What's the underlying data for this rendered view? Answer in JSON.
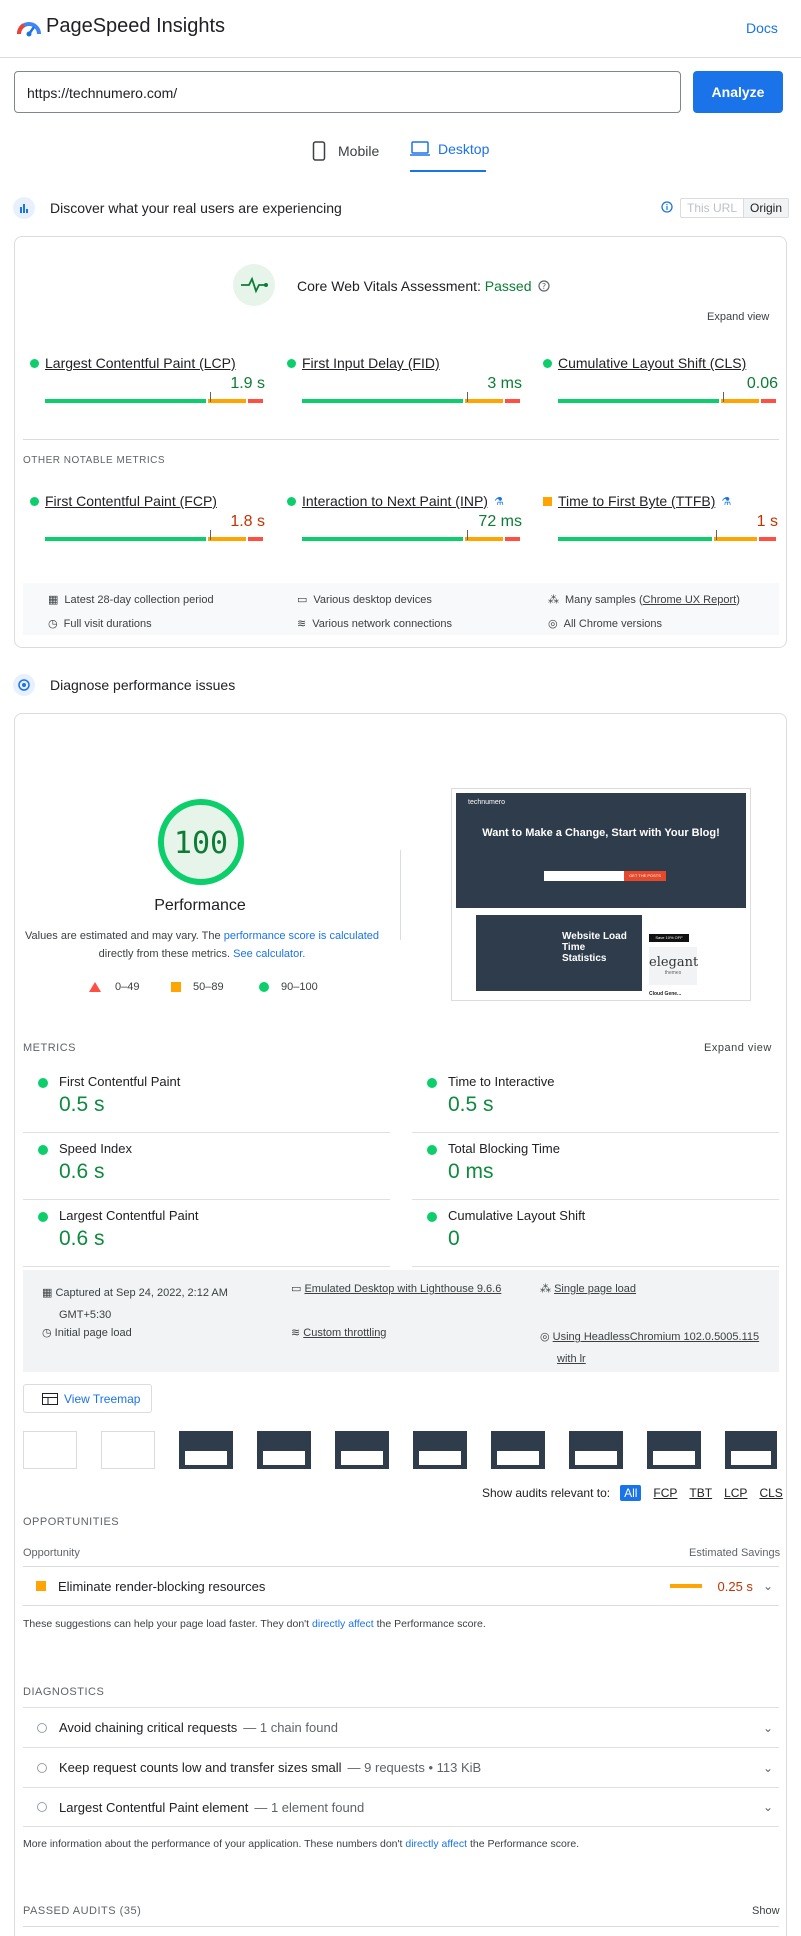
{
  "header": {
    "title": "PageSpeed Insights",
    "docs": "Docs"
  },
  "url_input": {
    "value": "https://technumero.com/",
    "analyze": "Analyze"
  },
  "tabs": [
    {
      "label": "Mobile"
    },
    {
      "label": "Desktop"
    }
  ],
  "real_users": {
    "heading": "Discover what your real users are experiencing",
    "toggle": [
      "This URL",
      "Origin"
    ],
    "cwv_label": "Core Web Vitals Assessment:",
    "cwv_status": "Passed",
    "expand": "Expand view",
    "metrics": [
      {
        "name": "Largest Contentful Paint (LCP)",
        "value": "1.9 s",
        "marker": 0.75
      },
      {
        "name": "First Input Delay (FID)",
        "value": "3 ms",
        "marker": 0.75
      },
      {
        "name": "Cumulative Layout Shift (CLS)",
        "value": "0.06",
        "marker": 0.75
      }
    ],
    "other_label": "OTHER NOTABLE METRICS",
    "other": [
      {
        "name": "First Contentful Paint (FCP)",
        "value": "1.8 s",
        "marker": 0.75
      },
      {
        "name": "Interaction to Next Paint (INP)",
        "value": "72 ms",
        "marker": 0.75
      },
      {
        "name": "Time to First Byte (TTFB)",
        "value": "1 s",
        "marker": 0.72
      }
    ],
    "footer": [
      "Latest 28-day collection period",
      "Various desktop devices",
      "Many samples (",
      "Chrome UX Report",
      ")",
      "Full visit durations",
      "Various network connections",
      "All Chrome versions"
    ]
  },
  "diagnose": {
    "heading": "Diagnose performance issues",
    "score": "100",
    "score_label": "Performance",
    "note1": "Values are estimated and may vary. The ",
    "note_link1": "performance score is calculated",
    "note2": "directly from these metrics. ",
    "note_link2": "See calculator.",
    "legend": [
      "0–49",
      "50–89",
      "90–100"
    ],
    "preview": {
      "brand": "technumero",
      "headline": "Want to Make a Change, Start with Your Blog!",
      "cta": "GET THE POSTS",
      "card_title": "Website Load Time Statistics",
      "ad_text": "elegant",
      "ad_sub": "themes",
      "ad_badge": "Save 10% OFF",
      "bottom": "Cloud Gene..."
    }
  },
  "lab": {
    "metrics_label": "METRICS",
    "expand": "Expand view",
    "metrics": [
      {
        "name": "First Contentful Paint",
        "value": "0.5 s"
      },
      {
        "name": "Time to Interactive",
        "value": "0.5 s"
      },
      {
        "name": "Speed Index",
        "value": "0.6 s"
      },
      {
        "name": "Total Blocking Time",
        "value": "0 ms"
      },
      {
        "name": "Largest Contentful Paint",
        "value": "0.6 s"
      },
      {
        "name": "Cumulative Layout Shift",
        "value": "0"
      }
    ],
    "info": [
      "Captured at Sep 24, 2022, 2:12 AM",
      "GMT+5:30",
      "Emulated Desktop with Lighthouse 9.6.6",
      "Single page load",
      "Initial page load",
      "Custom throttling",
      "Using HeadlessChromium 102.0.5005.115",
      "with lr"
    ],
    "treemap": "View Treemap",
    "filter_label": "Show audits relevant to:",
    "filters": [
      "All",
      "FCP",
      "TBT",
      "LCP",
      "CLS"
    ]
  },
  "opportunities": {
    "label": "OPPORTUNITIES",
    "col1": "Opportunity",
    "col2": "Estimated Savings",
    "item": "Eliminate render-blocking resources",
    "savings": "0.25 s",
    "note1": "These suggestions can help your page load faster. They don't ",
    "note_link": "directly affect",
    "note2": " the Performance score."
  },
  "diagnostics": {
    "label": "DIAGNOSTICS",
    "items": [
      {
        "title": "Avoid chaining critical requests",
        "detail": "— 1 chain found"
      },
      {
        "title": "Keep request counts low and transfer sizes small",
        "detail": "— 9 requests • 113 KiB"
      },
      {
        "title": "Largest Contentful Paint element",
        "detail": "— 1 element found"
      }
    ],
    "note1": "More information about the performance of your application. These numbers don't ",
    "note_link": "directly affect",
    "note2": " the Performance score."
  },
  "passed": {
    "label": "PASSED AUDITS",
    "count": "(35)",
    "show": "Show"
  }
}
